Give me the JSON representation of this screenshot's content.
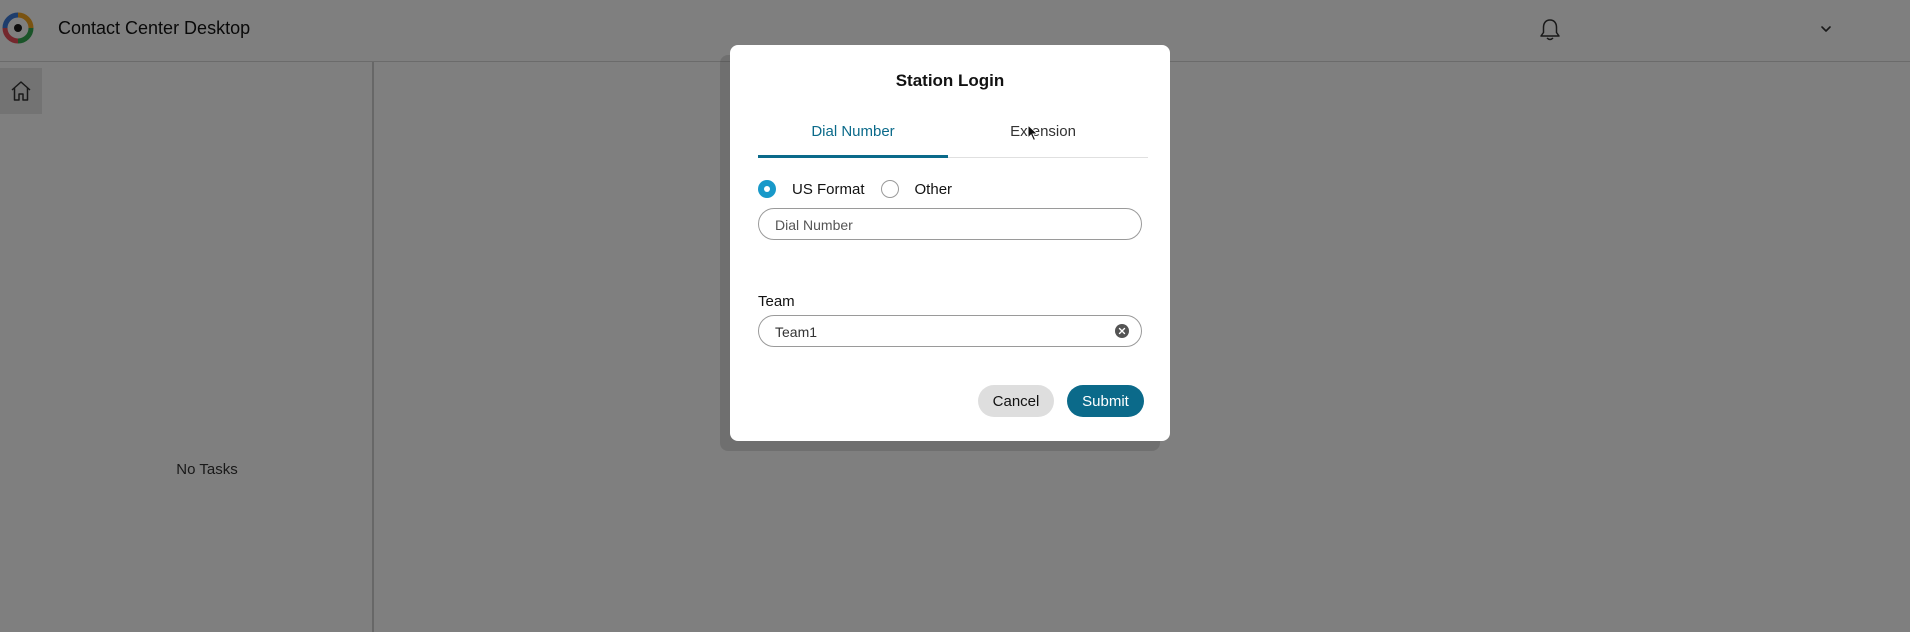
{
  "app": {
    "title": "Contact Center Desktop",
    "logo_icon": "webex-contact-center-logo-icon",
    "notification_icon": "bell-icon",
    "user_menu_icon": "chevron-down-icon"
  },
  "nav": {
    "home_icon": "home-icon"
  },
  "tasks": {
    "empty_text": "No Tasks"
  },
  "modal": {
    "title": "Station Login",
    "tabs": [
      {
        "label": "Dial Number",
        "active": true
      },
      {
        "label": "Extension",
        "active": false
      }
    ],
    "format_options": [
      {
        "label": "US Format",
        "checked": true
      },
      {
        "label": "Other",
        "checked": false
      }
    ],
    "dial_number": {
      "placeholder": "Dial Number",
      "value": ""
    },
    "team": {
      "label": "Team",
      "value": "Team1",
      "clear_icon": "clear-circle-icon"
    },
    "buttons": {
      "cancel": "Cancel",
      "submit": "Submit"
    }
  },
  "colors": {
    "accent": "#0b6a8a",
    "radio_checked": "#1899c9",
    "overlay": "rgba(0,0,0,0.5)"
  }
}
